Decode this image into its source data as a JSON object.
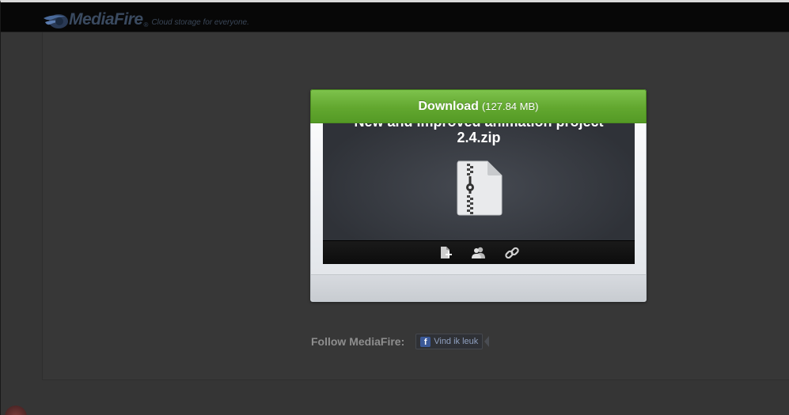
{
  "header": {
    "logo_text": "MediaFire",
    "logo_reg": "®",
    "tagline": "Cloud storage for everyone."
  },
  "download": {
    "label": "Download",
    "size": "(127.84 MB)"
  },
  "file": {
    "name_line1": "New and improved animation project",
    "name_line2": "2.4.zip",
    "icon": "zip-file-icon"
  },
  "toolbar": {
    "icons": [
      "add-to-account-icon",
      "share-users-icon",
      "link-icon"
    ]
  },
  "follow": {
    "label": "Follow MediaFire:",
    "fb_label": "Vind ik leuk",
    "fb_icon": "f"
  },
  "colors": {
    "accent_green": "#62a72f",
    "header_bg": "#070707",
    "page_bg": "#353535"
  }
}
